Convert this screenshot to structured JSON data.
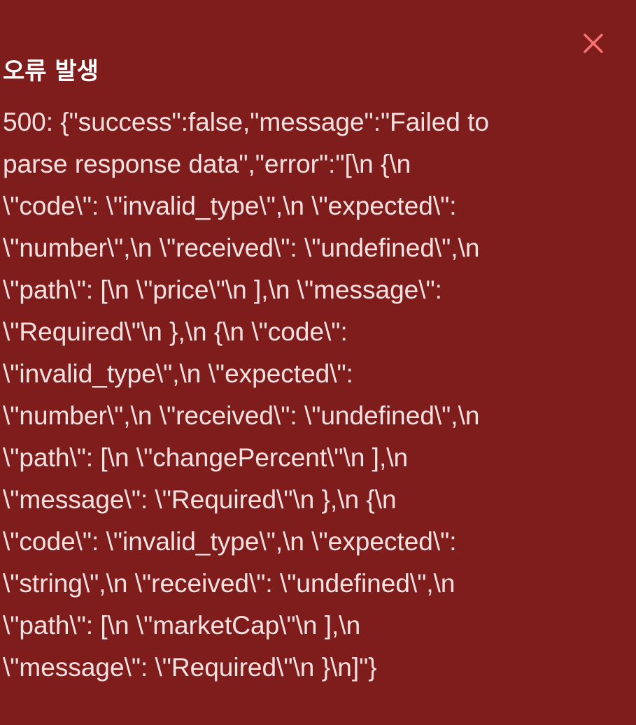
{
  "toast": {
    "title": "오류 발생",
    "close_icon": "close-icon",
    "accent_color": "#7f1d1d",
    "close_color": "#f87171",
    "message_lines": [
      "500: {\"success\":false,\"message\":\"Failed to",
      "parse response data\",\"error\":\"[\\n {\\n",
      "\\\"code\\\": \\\"invalid_type\\\",\\n \\\"expected\\\":",
      "\\\"number\\\",\\n \\\"received\\\": \\\"undefined\\\",\\n",
      "\\\"path\\\": [\\n \\\"price\\\"\\n ],\\n \\\"message\\\":",
      "\\\"Required\\\"\\n },\\n {\\n \\\"code\\\":",
      "\\\"invalid_type\\\",\\n \\\"expected\\\":",
      "\\\"number\\\",\\n \\\"received\\\": \\\"undefined\\\",\\n",
      "\\\"path\\\": [\\n \\\"changePercent\\\"\\n ],\\n",
      "\\\"message\\\": \\\"Required\\\"\\n },\\n {\\n",
      "\\\"code\\\": \\\"invalid_type\\\",\\n \\\"expected\\\":",
      "\\\"string\\\",\\n \\\"received\\\": \\\"undefined\\\",\\n",
      "\\\"path\\\": [\\n \\\"marketCap\\\"\\n ],\\n",
      "\\\"message\\\": \\\"Required\\\"\\n }\\n]\"}"
    ]
  }
}
